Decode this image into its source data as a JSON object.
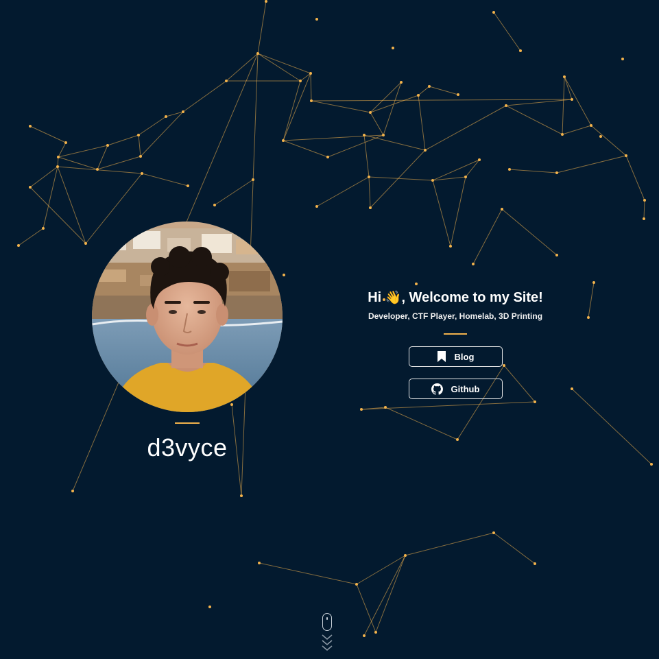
{
  "profile": {
    "handle": "d3vyce"
  },
  "intro": {
    "greeting_start": "Hi ",
    "wave_emoji": "👋",
    "greeting_end": ", Welcome to my Site!",
    "tagline": "Developer, CTF Player, Homelab, 3D Printing"
  },
  "buttons": [
    {
      "label": "Blog",
      "icon": "bookmark-icon"
    },
    {
      "label": "Github",
      "icon": "github-icon"
    }
  ],
  "scroll_hint": {
    "icon": "mouse-scroll-icon"
  },
  "colors": {
    "background": "#031a2f",
    "accent": "#f3b34c",
    "node": "#f3b34c",
    "text": "#ffffff"
  }
}
